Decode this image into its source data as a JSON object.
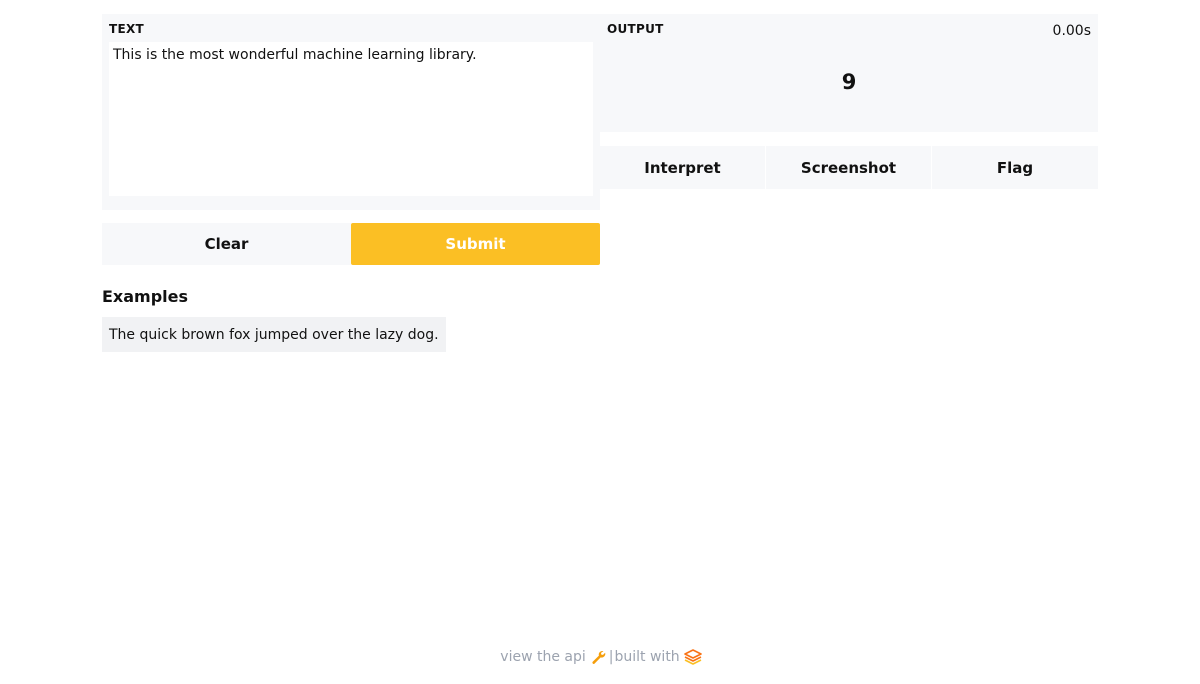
{
  "input": {
    "label": "TEXT",
    "value": "This is the most wonderful machine learning library."
  },
  "buttons": {
    "clear": "Clear",
    "submit": "Submit"
  },
  "examples": {
    "title": "Examples",
    "items": [
      "The quick brown fox jumped over the lazy dog."
    ]
  },
  "output": {
    "label": "OUTPUT",
    "time": "0.00s",
    "value": "9"
  },
  "actions": {
    "interpret": "Interpret",
    "screenshot": "Screenshot",
    "flag": "Flag"
  },
  "footer": {
    "api_link": "view the api",
    "separator": "|",
    "built_with": "built with"
  },
  "colors": {
    "accent": "#fbbf24",
    "panel_bg": "#f7f8fa",
    "footer_text": "#9ca3af"
  },
  "icons": {
    "api": "wrench-icon",
    "brand": "gradio-logo-icon"
  }
}
